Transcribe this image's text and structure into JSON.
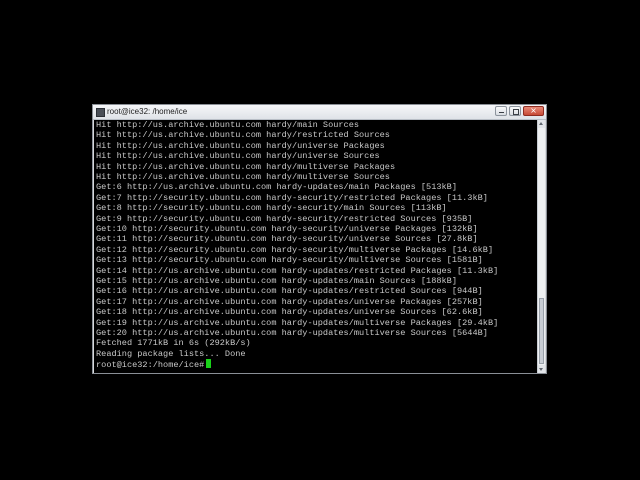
{
  "window": {
    "title": "root@ice32: /home/ice",
    "close_glyph": "×"
  },
  "terminal": {
    "lines": [
      "Hit http://us.archive.ubuntu.com hardy/main Sources",
      "Hit http://us.archive.ubuntu.com hardy/restricted Sources",
      "Hit http://us.archive.ubuntu.com hardy/universe Packages",
      "Hit http://us.archive.ubuntu.com hardy/universe Sources",
      "Hit http://us.archive.ubuntu.com hardy/multiverse Packages",
      "Hit http://us.archive.ubuntu.com hardy/multiverse Sources",
      "Get:6 http://us.archive.ubuntu.com hardy-updates/main Packages [513kB]",
      "Get:7 http://security.ubuntu.com hardy-security/restricted Packages [11.3kB]",
      "Get:8 http://security.ubuntu.com hardy-security/main Sources [113kB]",
      "Get:9 http://security.ubuntu.com hardy-security/restricted Sources [935B]",
      "Get:10 http://security.ubuntu.com hardy-security/universe Packages [132kB]",
      "Get:11 http://security.ubuntu.com hardy-security/universe Sources [27.8kB]",
      "Get:12 http://security.ubuntu.com hardy-security/multiverse Packages [14.6kB]",
      "Get:13 http://security.ubuntu.com hardy-security/multiverse Sources [1581B]",
      "Get:14 http://us.archive.ubuntu.com hardy-updates/restricted Packages [11.3kB]",
      "Get:15 http://us.archive.ubuntu.com hardy-updates/main Sources [188kB]",
      "Get:16 http://us.archive.ubuntu.com hardy-updates/restricted Sources [944B]",
      "Get:17 http://us.archive.ubuntu.com hardy-updates/universe Packages [257kB]",
      "Get:18 http://us.archive.ubuntu.com hardy-updates/universe Sources [62.6kB]",
      "Get:19 http://us.archive.ubuntu.com hardy-updates/multiverse Packages [29.4kB]",
      "Get:20 http://us.archive.ubuntu.com hardy-updates/multiverse Sources [5644B]",
      "Fetched 1771kB in 6s (292kB/s)",
      "Reading package lists... Done"
    ],
    "prompt": "root@ice32:/home/ice#"
  },
  "colors": {
    "terminal_bg": "#000000",
    "terminal_fg": "#c8c8c8",
    "cursor": "#19d219",
    "close_button": "#c74a35"
  },
  "icons": {
    "app": "terminal-icon",
    "minimize": "minimize-icon",
    "maximize": "maximize-icon",
    "close": "close-icon",
    "scroll_up": "arrow-up-icon",
    "scroll_down": "arrow-down-icon"
  },
  "scrollbar": {
    "position_fraction": 1.0
  }
}
